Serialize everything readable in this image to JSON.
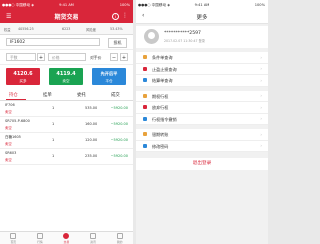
{
  "left": {
    "status": {
      "carrier": "●●●○ 中国移动 ◈",
      "time": "9:41 AM",
      "battery": "100%"
    },
    "app_title": "期货交易",
    "account": {
      "label": "权益",
      "equity": "40556.25",
      "available": "6223",
      "risk_label": "风险度",
      "risk": "53.43%"
    },
    "symbol": {
      "value": "IF1602",
      "button": "投机"
    },
    "inputs": {
      "qty_placeholder": "手数",
      "price_placeholder": "价格",
      "price_label": "对手价"
    },
    "buttons": [
      {
        "price": "4120.6",
        "label": "买多",
        "color": "#d9263a"
      },
      {
        "price": "4119.4",
        "label": "卖空",
        "color": "#1aa352"
      },
      {
        "price": "先开后平",
        "label": "平仓",
        "color": "#2b88d9"
      }
    ],
    "tabs": [
      "持仓",
      "挂单",
      "委托",
      "成交"
    ],
    "positions": [
      {
        "name": "IF706",
        "dir": "卖空",
        "qty": "1",
        "price": "535.00",
        "pnl": "−5920.00"
      },
      {
        "name": "SR705-P-6800",
        "dir": "卖空",
        "qty": "1",
        "price": "160.00",
        "pnl": "−5920.00"
      },
      {
        "name": "白糖1605",
        "dir": "卖空",
        "qty": "1",
        "price": "120.00",
        "pnl": "−5920.00"
      },
      {
        "name": "SR603",
        "dir": "卖空",
        "qty": "1",
        "price": "235.00",
        "pnl": "−5920.00"
      }
    ],
    "nav": [
      "首页",
      "行情",
      "交易",
      "资讯",
      "我的"
    ]
  },
  "right": {
    "status": {
      "carrier": "●●●○ 中国移动 ◈",
      "time": "9:41 AM",
      "battery": "100%"
    },
    "title": "更多",
    "account_id": "***********2597",
    "last_login": "2017.02.07 11:30:47 登录",
    "menu": [
      {
        "label": "条件单查询",
        "icon": "condition-icon",
        "color": "#e8a23c"
      },
      {
        "label": "止盈止损查询",
        "icon": "stop-icon",
        "color": "#d9263a"
      },
      {
        "label": "结算单查询",
        "icon": "settle-icon",
        "color": "#2b88d9"
      },
      {
        "label": "期权行权",
        "icon": "option-icon",
        "color": "#e8a23c"
      },
      {
        "label": "放弃行权",
        "icon": "abandon-icon",
        "color": "#d9263a"
      },
      {
        "label": "行权指令撤销",
        "icon": "revoke-icon",
        "color": "#2b88d9"
      },
      {
        "label": "银期转账",
        "icon": "transfer-icon",
        "color": "#e8a23c"
      },
      {
        "label": "修改密码",
        "icon": "password-icon",
        "color": "#2b88d9"
      }
    ],
    "logout": "退出登录"
  }
}
